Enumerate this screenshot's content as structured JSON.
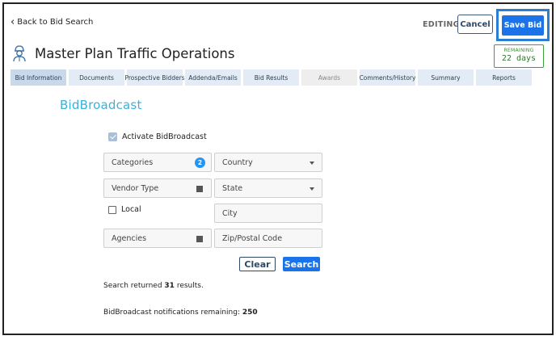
{
  "header": {
    "back_label": "Back to Bid Search",
    "editing_label": "EDITING",
    "cancel_label": "Cancel",
    "save_label": "Save Bid",
    "title": "Master Plan Traffic Operations",
    "title_icon": "person-hardhat-icon",
    "remaining_label": "REMAINING",
    "remaining_value": "22 days"
  },
  "tabs": [
    {
      "label": "Bid Information",
      "state": "active"
    },
    {
      "label": "Documents",
      "state": "normal"
    },
    {
      "label": "Prospective Bidders",
      "state": "normal"
    },
    {
      "label": "Addenda/Emails",
      "state": "normal"
    },
    {
      "label": "Bid Results",
      "state": "normal"
    },
    {
      "label": "Awards",
      "state": "disabled"
    },
    {
      "label": "Comments/History",
      "state": "normal"
    },
    {
      "label": "Summary",
      "state": "normal"
    },
    {
      "label": "Reports",
      "state": "normal"
    }
  ],
  "section": {
    "title": "BidBroadcast",
    "activate_label": "Activate BidBroadcast",
    "activate_checked": true,
    "categories_label": "Categories",
    "categories_count": "2",
    "vendor_type_label": "Vendor Type",
    "local_label": "Local",
    "local_checked": false,
    "agencies_label": "Agencies",
    "country_placeholder": "Country",
    "state_placeholder": "State",
    "city_placeholder": "City",
    "zip_placeholder": "Zip/Postal Code",
    "clear_label": "Clear",
    "search_label": "Search",
    "result_prefix": "Search returned ",
    "result_count": "31",
    "result_suffix": " results.",
    "notif_prefix": "BidBroadcast notifications remaining: ",
    "notif_count": "250"
  },
  "colors": {
    "primary_button": "#1a73e8",
    "section_title": "#3db2d8",
    "remaining_green": "#3ca03c",
    "tab_background": "#e3ecf6"
  }
}
